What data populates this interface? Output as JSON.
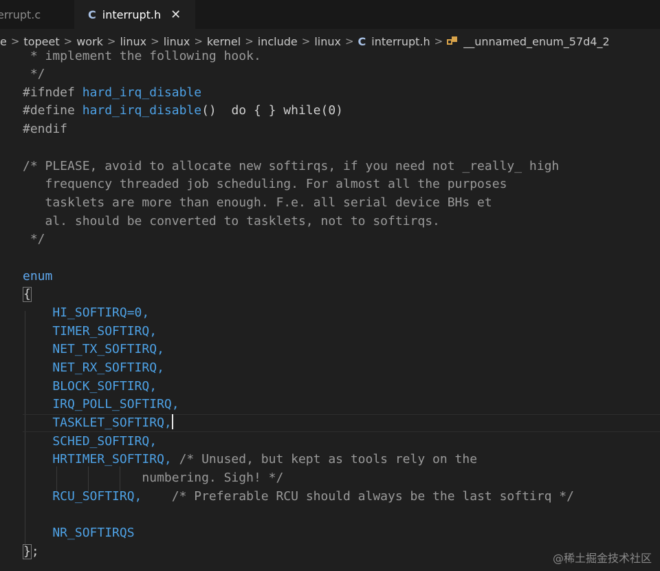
{
  "tabs": [
    {
      "label": "errupt.c",
      "active": false
    },
    {
      "label": "interrupt.h",
      "active": true,
      "close": "✕"
    }
  ],
  "breadcrumb": {
    "items": [
      "e",
      "topeet",
      "work",
      "linux",
      "linux",
      "kernel",
      "include",
      "linux",
      "interrupt.h",
      "__unnamed_enum_57d4_2"
    ],
    "separator": ">",
    "file_icon": "C"
  },
  "code": {
    "lines": [
      " * implement the following hook.",
      " */",
      "#ifndef hard_irq_disable",
      "#define hard_irq_disable()  do { } while(0)",
      "#endif",
      "",
      "/* PLEASE, avoid to allocate new softirqs, if you need not _really_ high",
      "   frequency threaded job scheduling. For almost all the purposes",
      "   tasklets are more than enough. F.e. all serial device BHs et",
      "   al. should be converted to tasklets, not to softirqs.",
      " */",
      "",
      "enum",
      "{",
      "    HI_SOFTIRQ=0,",
      "    TIMER_SOFTIRQ,",
      "    NET_TX_SOFTIRQ,",
      "    NET_RX_SOFTIRQ,",
      "    BLOCK_SOFTIRQ,",
      "    IRQ_POLL_SOFTIRQ,",
      "    TASKLET_SOFTIRQ,",
      "    SCHED_SOFTIRQ,",
      "    HRTIMER_SOFTIRQ, /* Unused, but kept as tools rely on the",
      "                numbering. Sigh! */",
      "    RCU_SOFTIRQ,    /* Preferable RCU should always be the last softirq */",
      "",
      "    NR_SOFTIRQS",
      "};"
    ]
  },
  "watermark": "@稀土掘金技术社区"
}
